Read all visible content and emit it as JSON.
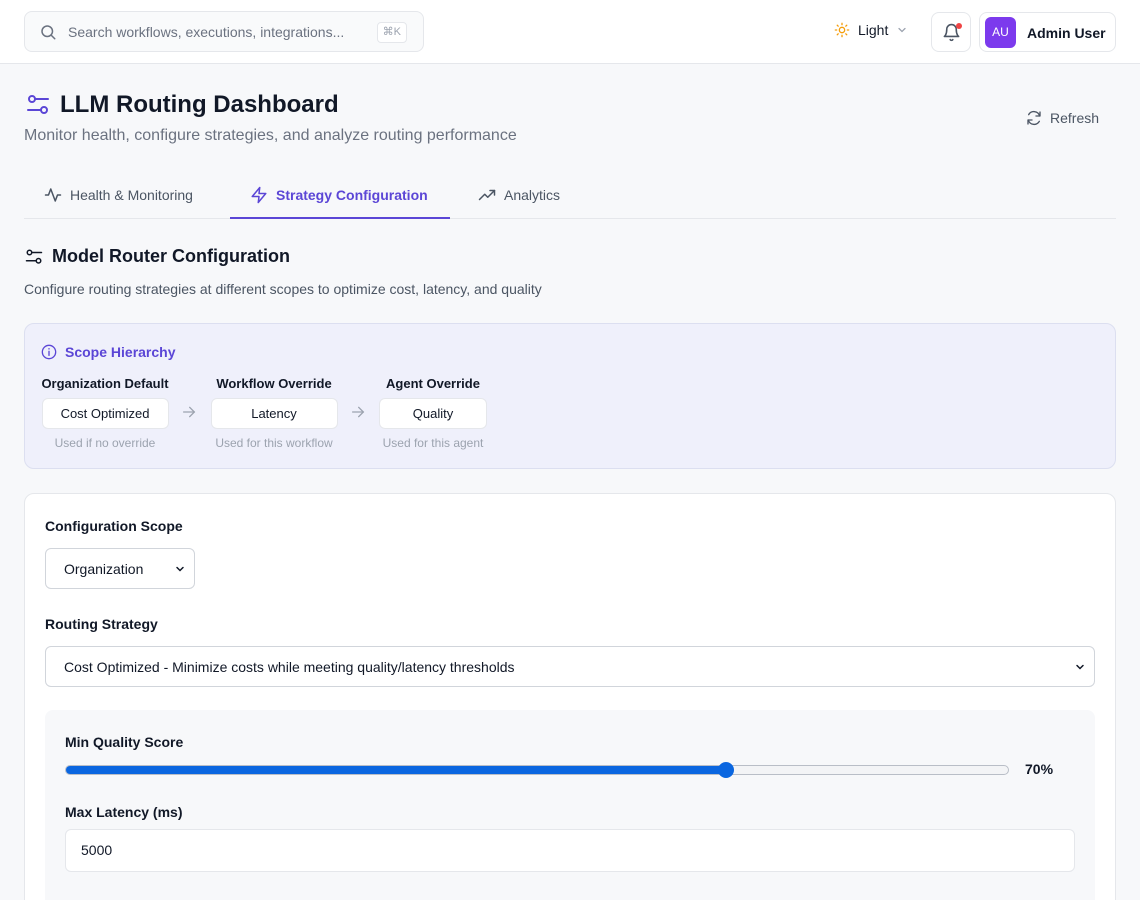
{
  "topbar": {
    "search_placeholder": "Search workflows, executions, integrations...",
    "search_shortcut": "⌘K",
    "theme_label": "Light",
    "user": {
      "initials": "AU",
      "name": "Admin User"
    }
  },
  "header": {
    "title": "LLM Routing Dashboard",
    "subtitle": "Monitor health, configure strategies, and analyze routing performance",
    "refresh_label": "Refresh"
  },
  "tabs": [
    {
      "label": "Health & Monitoring",
      "active": false
    },
    {
      "label": "Strategy Configuration",
      "active": true
    },
    {
      "label": "Analytics",
      "active": false
    }
  ],
  "section": {
    "title": "Model Router Configuration",
    "subtitle": "Configure routing strategies at different scopes to optimize cost, latency, and quality"
  },
  "scope_hierarchy": {
    "title": "Scope Hierarchy",
    "levels": [
      {
        "label": "Organization Default",
        "value": "Cost Optimized",
        "note": "Used if no override"
      },
      {
        "label": "Workflow Override",
        "value": "Latency",
        "note": "Used for this workflow"
      },
      {
        "label": "Agent Override",
        "value": "Quality",
        "note": "Used for this agent"
      }
    ]
  },
  "config": {
    "scope_label": "Configuration Scope",
    "scope_value": "Organization",
    "strategy_label": "Routing Strategy",
    "strategy_value": "Cost Optimized - Minimize costs while meeting quality/latency thresholds",
    "min_quality_label": "Min Quality Score",
    "min_quality_value": 70,
    "min_quality_display": "70%",
    "max_latency_label": "Max Latency (ms)",
    "max_latency_value": "5000"
  },
  "colors": {
    "accent": "#5b46d6",
    "slider": "#0a66e0",
    "avatar": "#7c3aed",
    "notification_dot": "#ef4444",
    "sun_icon": "#f59e0b"
  }
}
